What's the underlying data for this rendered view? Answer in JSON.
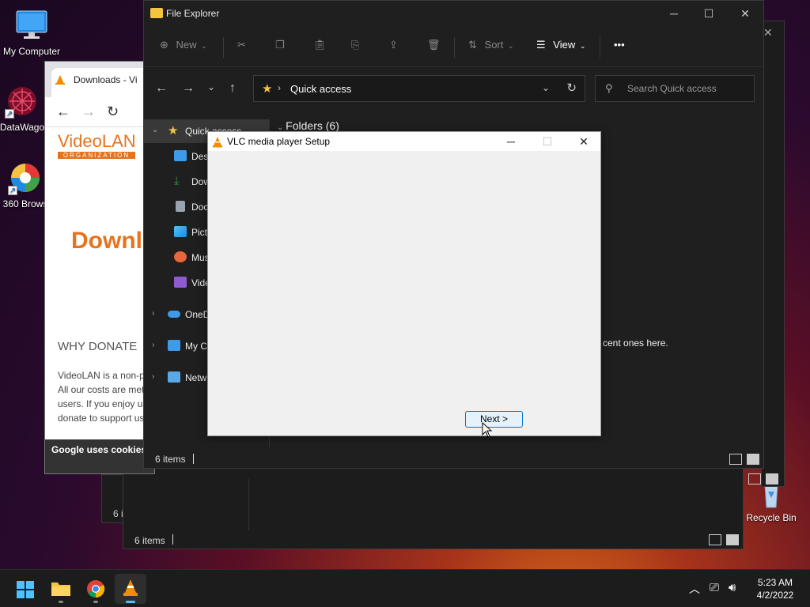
{
  "desktop": {
    "icons": [
      {
        "label": "My Computer"
      },
      {
        "label": "DataWago"
      },
      {
        "label": "360 Brows"
      },
      {
        "label": "Recycle Bin"
      }
    ]
  },
  "browser": {
    "tab_title": "Downloads - Vi",
    "logo_main": "VideoLAN",
    "logo_sub": "ORGANIZATION",
    "heading": "Downl",
    "why_donate": "WHY DONATE",
    "para_lines": [
      "VideoLAN is a non-p",
      "All our costs are met",
      "users. If you enjoy u",
      "donate to support us"
    ],
    "cookie_text": "Google uses cookies"
  },
  "explorer": {
    "title": "File Explorer",
    "toolbar": {
      "new_label": "New",
      "sort_label": "Sort",
      "view_label": "View",
      "more_label": "•••"
    },
    "address": "Quick access",
    "search_placeholder": "Search Quick access",
    "nav": [
      {
        "label": "Quick access",
        "color": "#f5c342"
      },
      {
        "label": "Desk",
        "color": "#3d9be9"
      },
      {
        "label": "Dow",
        "color": "#2ea043"
      },
      {
        "label": "Docu",
        "color": "#9aa4b0"
      },
      {
        "label": "Pictu",
        "color": "#3d9be9"
      },
      {
        "label": "Musi",
        "color": "#e6673c"
      },
      {
        "label": "Vide",
        "color": "#8e5ccf"
      },
      {
        "label": "OneD",
        "color": "#3d9be9"
      },
      {
        "label": "My Co",
        "color": "#3d9be9"
      },
      {
        "label": "Netw",
        "color": "#3d9be9"
      }
    ],
    "folders_header": "Folders (6)",
    "recent_text": "cent ones here.",
    "status_count": "6 items"
  },
  "back_explorer": {
    "status_count": "6 items",
    "status_count_partial": "6 i"
  },
  "vlc_dialog": {
    "title": "VLC media player Setup",
    "next_label": "Next >"
  },
  "taskbar": {
    "apps": [
      "start",
      "file-explorer",
      "chrome",
      "vlc"
    ],
    "time": "5:23 AM",
    "date": "4/2/2022"
  },
  "colors": {
    "accent": "#0078d7",
    "vlc_orange": "#f28c00",
    "videolan_orange": "#e6731e"
  }
}
